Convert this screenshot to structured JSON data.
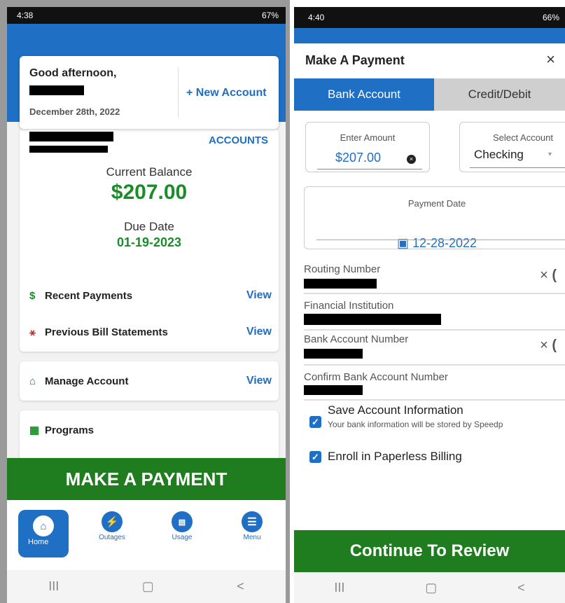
{
  "left": {
    "status": {
      "time": "4:38",
      "battery": "67%"
    },
    "greeting": {
      "title": "Good afternoon,",
      "date": "December 28th, 2022",
      "new_account": "+ New Account"
    },
    "account": {
      "accounts_link": "ACCOUNTS",
      "current_balance_label": "Current Balance",
      "current_balance": "$207.00",
      "due_date_label": "Due Date",
      "due_date": "01-19-2023",
      "rows": [
        {
          "label": "Recent Payments",
          "action": "View",
          "icon": "dollar-icon"
        },
        {
          "label": "Previous Bill Statements",
          "action": "View",
          "icon": "mailbox-icon"
        }
      ]
    },
    "manage": {
      "label": "Manage Account",
      "action": "View",
      "icon": "home-outline-icon"
    },
    "programs": {
      "label": "Programs",
      "icon": "programs-icon"
    },
    "make_payment": "MAKE A PAYMENT",
    "bottom_nav": [
      {
        "label": "Home",
        "icon": "home-icon"
      },
      {
        "label": "Outages",
        "icon": "bolt-icon"
      },
      {
        "label": "Usage",
        "icon": "chart-icon"
      },
      {
        "label": "Menu",
        "icon": "menu-icon"
      }
    ],
    "system_nav": [
      "III",
      "▢",
      "<"
    ]
  },
  "right": {
    "status": {
      "time": "4:40",
      "battery": "66%"
    },
    "title": "Make A Payment",
    "close": "×",
    "tabs": {
      "bank": "Bank Account",
      "credit": "Credit/Debit"
    },
    "amount": {
      "label": "Enter Amount",
      "value": "$207.00"
    },
    "select_account": {
      "label": "Select Account",
      "value": "Checking"
    },
    "payment_date": {
      "label": "Payment Date",
      "value": "12-28-2022"
    },
    "fields": {
      "routing": "Routing Number",
      "institution": "Financial Institution",
      "account_number": "Bank Account Number",
      "confirm_account_number": "Confirm Bank Account Number"
    },
    "save_info": {
      "label": "Save Account Information",
      "sub": "Your bank information will be stored by Speedp"
    },
    "paperless": {
      "label": "Enroll in Paperless Billing"
    },
    "continue": "Continue To Review",
    "system_nav": [
      "III",
      "▢",
      "<"
    ]
  },
  "colors": {
    "primary": "#1f6fc5",
    "success": "#1a8c2a",
    "cta": "#1f7d1f"
  }
}
